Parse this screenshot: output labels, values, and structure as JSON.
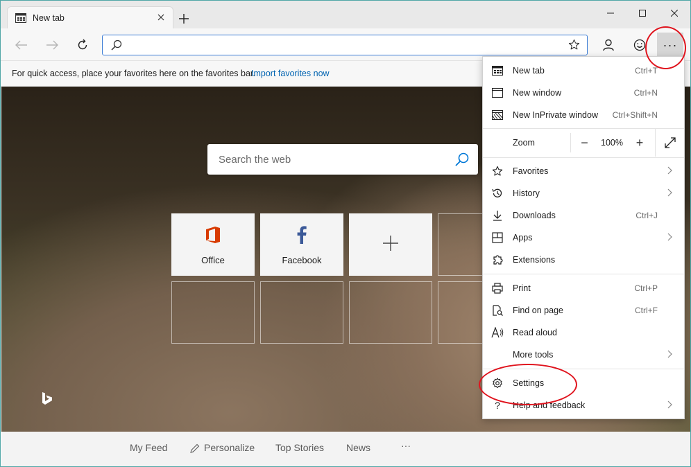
{
  "tab": {
    "title": "New tab"
  },
  "favorites_bar": {
    "text": "For quick access, place your favorites here on the favorites bar.",
    "link": "Import favorites now"
  },
  "search": {
    "placeholder": "Search the web"
  },
  "tiles": [
    {
      "label": "Office",
      "icon": "office-icon"
    },
    {
      "label": "Facebook",
      "icon": "facebook-icon"
    },
    {
      "label": "",
      "icon": "add-icon"
    }
  ],
  "bottom_bar": {
    "items": [
      "My Feed",
      "Personalize",
      "Top Stories",
      "News",
      "···"
    ]
  },
  "menu": {
    "new_tab": {
      "label": "New tab",
      "shortcut": "Ctrl+T"
    },
    "new_window": {
      "label": "New window",
      "shortcut": "Ctrl+N"
    },
    "new_inprivate": {
      "label": "New InPrivate window",
      "shortcut": "Ctrl+Shift+N"
    },
    "zoom": {
      "label": "Zoom",
      "value": "100%",
      "minus": "−",
      "plus": "+"
    },
    "favorites": {
      "label": "Favorites"
    },
    "history": {
      "label": "History"
    },
    "downloads": {
      "label": "Downloads",
      "shortcut": "Ctrl+J"
    },
    "apps": {
      "label": "Apps"
    },
    "extensions": {
      "label": "Extensions"
    },
    "print": {
      "label": "Print",
      "shortcut": "Ctrl+P"
    },
    "find": {
      "label": "Find on page",
      "shortcut": "Ctrl+F"
    },
    "read_aloud": {
      "label": "Read aloud"
    },
    "more_tools": {
      "label": "More tools"
    },
    "settings": {
      "label": "Settings"
    },
    "help": {
      "label": "Help and feedback"
    }
  },
  "toolbar": {
    "more_label": "···"
  },
  "colors": {
    "accent": "#0063b1",
    "highlight": "#e0141e",
    "office": "#d83b01",
    "facebook": "#3b5998"
  }
}
